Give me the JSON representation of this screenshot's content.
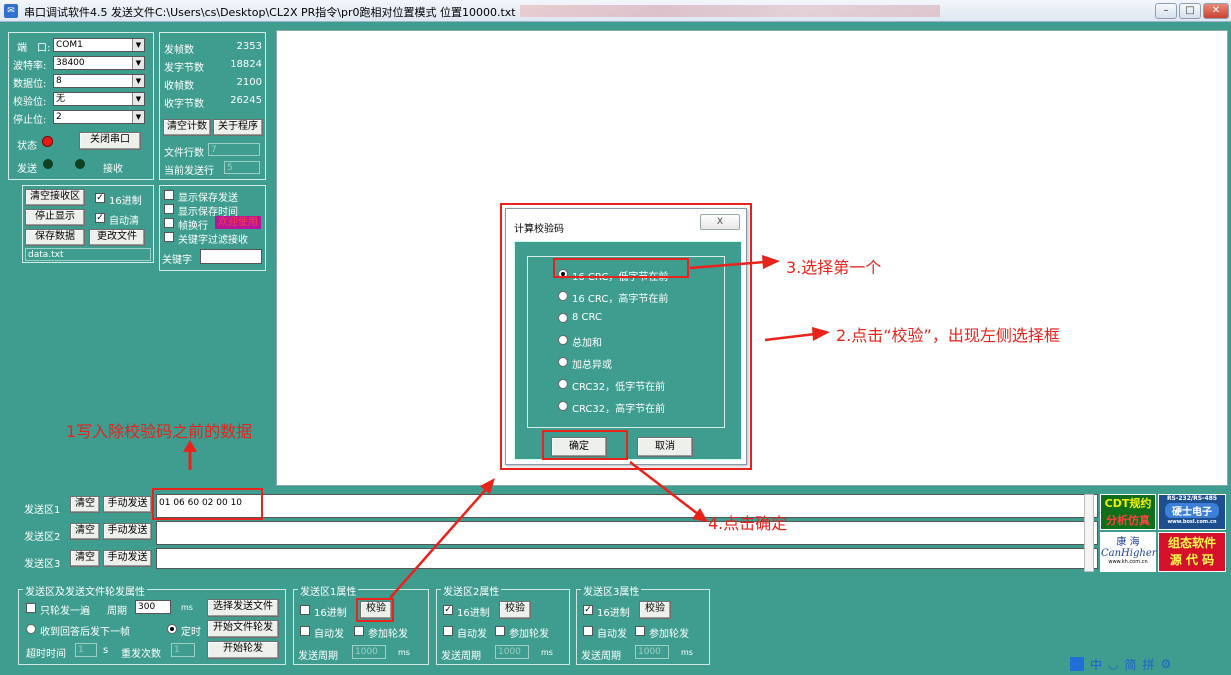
{
  "window": {
    "title": "串口调试软件4.5 发送文件C:\\Users\\cs\\Desktop\\CL2X PR指令\\pr0跑相对位置模式 位置10000.txt"
  },
  "port_settings": {
    "port_label": "端　口:",
    "port_value": "COM1",
    "baud_label": "波特率:",
    "baud_value": "38400",
    "databits_label": "数据位:",
    "databits_value": "8",
    "parity_label": "校验位:",
    "parity_value": "无",
    "stopbits_label": "停止位:",
    "stopbits_value": "2",
    "status_label": "状态",
    "close_port": "关闭串口",
    "send_label": "发送",
    "recv_label": "接收"
  },
  "counters": {
    "tx_frames_label": "发帧数",
    "tx_frames": "2353",
    "tx_bytes_label": "发字节数",
    "tx_bytes": "18824",
    "rx_frames_label": "收帧数",
    "rx_frames": "2100",
    "rx_bytes_label": "收字节数",
    "rx_bytes": "26245",
    "clear_count": "清空计数",
    "about": "关于程序",
    "file_lines_label": "文件行数",
    "file_lines": "7",
    "current_line_label": "当前发送行",
    "current_line": "5"
  },
  "recv_controls": {
    "clear_recv": "清空接收区",
    "hex16": "16进制",
    "stop_display": "停止显示",
    "auto_clear": "自动清",
    "save_data": "保存数据",
    "change_file": "更改文件",
    "file_name": "data.txt"
  },
  "display_options": {
    "show_save_send": "显示保存发送",
    "show_save_time": "显示保存时间",
    "frame_newline": "帧换行",
    "welcome": "欢迎使用",
    "keyword_filter": "关键字过滤接收",
    "keyword_label": "关键字"
  },
  "dialog": {
    "title": "计算校验码",
    "close": "X",
    "options": [
      "16 CRC，低字节在前",
      "16 CRC，高字节在前",
      "8 CRC",
      "总加和",
      "加总异或",
      "CRC32，低字节在前",
      "CRC32，高字节在前"
    ],
    "selected_index": 0,
    "ok": "确定",
    "cancel": "取消"
  },
  "annotations": {
    "a1": "1写入除校验码之前的数据",
    "a2": "2.点击“校验”，出现左侧选择框",
    "a3": "3.选择第一个",
    "a4": "4.点击确定"
  },
  "send_areas": [
    {
      "label": "发送区1",
      "clear": "清空",
      "manual": "手动发送",
      "text": "01 06 60 02 00 10"
    },
    {
      "label": "发送区2",
      "clear": "清空",
      "manual": "手动发送",
      "text": ""
    },
    {
      "label": "发送区3",
      "clear": "清空",
      "manual": "手动发送",
      "text": ""
    }
  ],
  "ads": {
    "cdt1": "CDT规约",
    "cdt2": "分析仿真",
    "rs_top": "RS-232/RS-485",
    "rs_mid": "硬士电子",
    "rs_url": "www.bosl.com.cn",
    "kh1": "康 海",
    "kh2": "CanHigher",
    "kh3": "www.kh.com.cn",
    "zt1": "组态软件",
    "zt2": "源 代 码"
  },
  "bottom": {
    "rotate_group": "发送区及发送文件轮发属性",
    "once_label": "只轮发一遍",
    "period_label": "周期",
    "period_value": "300",
    "ms": "ms",
    "select_file": "选择发送文件",
    "wait_reply": "收到回答后发下一帧",
    "timed": "定时",
    "start_file_rotate": "开始文件轮发",
    "timeout_label": "超时时间",
    "timeout_value": "1",
    "s": "s",
    "retry_label": "重发次数",
    "retry_value": "1",
    "start_rotate": "开始轮发",
    "area1_group": "发送区1属性",
    "area2_group": "发送区2属性",
    "area3_group": "发送区3属性",
    "hex16": "16进制",
    "checksum": "校验",
    "auto_send": "自动发",
    "join_rotate": "参加轮发",
    "send_period": "发送周期",
    "period_default": "1000"
  },
  "tray": [
    "中",
    "简",
    "拼",
    "⚙"
  ]
}
